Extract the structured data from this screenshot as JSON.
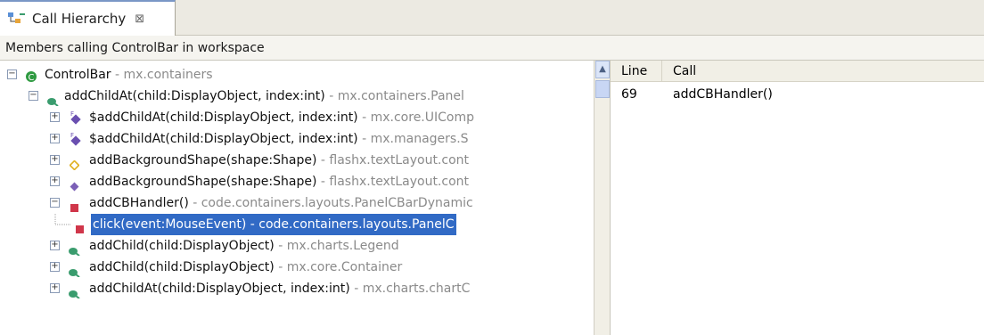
{
  "view_tab": {
    "title": "Call Hierarchy",
    "icon": "call-hierarchy-icon",
    "close_glyph": "⊠"
  },
  "description": "Members calling ControlBar in workspace",
  "tree": {
    "rows": [
      {
        "name": "ControlBar",
        "pkg": " - mx.containers",
        "icon": "class-icon",
        "toggle": "−"
      },
      {
        "name": "addChildAt(child:DisplayObject, index:int)",
        "pkg": " - mx.containers.Panel",
        "icon": "public-method-icon",
        "toggle": "−"
      },
      {
        "name": "$addChildAt(child:DisplayObject, index:int)",
        "pkg": " - mx.core.UIComp",
        "icon": "final-method-icon",
        "toggle": "+"
      },
      {
        "name": "$addChildAt(child:DisplayObject, index:int)",
        "pkg": " - mx.managers.S",
        "icon": "final-method-icon",
        "toggle": "+"
      },
      {
        "name": "addBackgroundShape(shape:Shape)",
        "pkg": " - flashx.textLayout.cont",
        "icon": "protected-method-icon",
        "toggle": "+"
      },
      {
        "name": "addBackgroundShape(shape:Shape)",
        "pkg": " - flashx.textLayout.cont",
        "icon": "internal-method-icon",
        "toggle": "+"
      },
      {
        "name": "addCBHandler()",
        "pkg": " - code.containers.layouts.PanelCBarDynamic",
        "icon": "private-method-icon",
        "toggle": "−"
      },
      {
        "name": "click(event:MouseEvent)",
        "pkg": " - code.containers.layouts.PanelC",
        "icon": "private-method-icon",
        "toggle": ""
      },
      {
        "name": "addChild(child:DisplayObject)",
        "pkg": " - mx.charts.Legend",
        "icon": "public-method-icon",
        "toggle": "+"
      },
      {
        "name": "addChild(child:DisplayObject)",
        "pkg": " - mx.core.Container",
        "icon": "public-method-icon",
        "toggle": "+"
      },
      {
        "name": "addChildAt(child:DisplayObject, index:int)",
        "pkg": " - mx.charts.chartC",
        "icon": "public-method-icon",
        "toggle": "+"
      }
    ]
  },
  "scrollbar": {
    "up_glyph": "▲"
  },
  "locations": {
    "headers": {
      "line": "Line",
      "call": "Call"
    },
    "rows": [
      {
        "line": "69",
        "call": "addCBHandler()"
      }
    ]
  },
  "colors": {
    "selection": "#316ac5",
    "class_icon": "#2f9a41",
    "public_method": "#3a9c6e",
    "protected_method": "#e0b020",
    "internal_method": "#7b5fb6",
    "private_method": "#d0364a"
  }
}
